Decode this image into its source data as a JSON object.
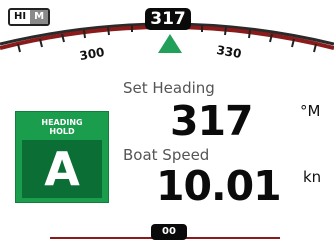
{
  "mode": {
    "hi": "HI",
    "m": "M"
  },
  "compass": {
    "heading": "317",
    "tick_left": "300",
    "tick_right": "330",
    "arc_color": "#8b1a1a",
    "marker_color": "#22a05a",
    "marker_icon": "up-triangle-icon"
  },
  "set_heading": {
    "label": "Set Heading",
    "value": "317",
    "unit": "°M"
  },
  "boat_speed": {
    "label": "Boat Speed",
    "value": "10.01",
    "unit": "kn"
  },
  "hold_panel": {
    "line1": "HEADING",
    "line2": "HOLD",
    "mode_letter": "A",
    "color": "#1a9e4d"
  },
  "bottom": {
    "value": "00"
  }
}
